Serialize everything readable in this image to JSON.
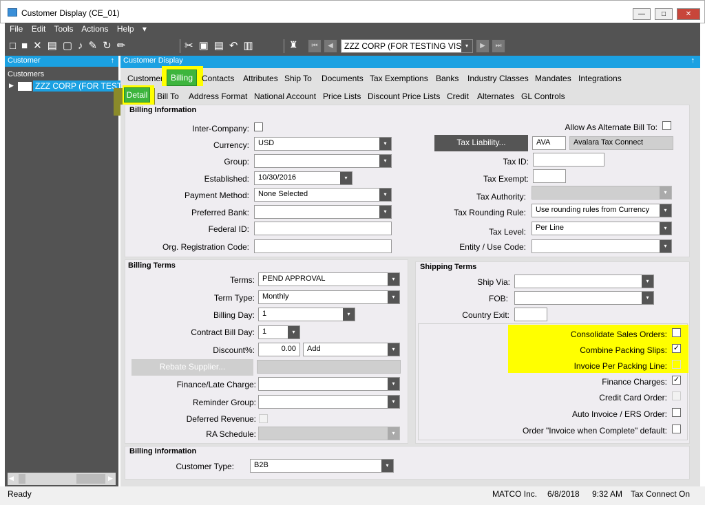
{
  "window": {
    "title": "Customer Display (CE_01)",
    "btn_min": "—",
    "btn_max": "□",
    "btn_close": "✕"
  },
  "menu": [
    "File",
    "Edit",
    "Tools",
    "Actions",
    "Help"
  ],
  "menu_more": "▾",
  "toolbar": {
    "icons": "□■✕▤▢♪✎↻✏",
    "icons2": "✂▣▤↶▥",
    "combo_value": "ZZZ CORP (FOR TESTING VIS",
    "combo_arrow": "▾",
    "nav_first": "⏮",
    "nav_prev": "◀",
    "nav_next": "▶",
    "nav_last": "⏭",
    "binoculars": "♜"
  },
  "left": {
    "header": "Customer",
    "pin": "↑",
    "section": "Customers",
    "node": "ZZZ CORP (FOR TEST",
    "expander": "▶"
  },
  "main_header": {
    "title": "Customer Display",
    "pin": "↑"
  },
  "tabs": [
    "Customer",
    "Billing",
    "Contacts",
    "Attributes",
    "Ship To",
    "Documents",
    "Tax Exemptions",
    "Banks",
    "Industry Classes",
    "Mandates",
    "Integrations"
  ],
  "subtabs": [
    "Detail",
    "Bill To",
    "Address Format",
    "National Account",
    "Price Lists",
    "Discount Price Lists",
    "Credit",
    "Alternates",
    "GL Controls"
  ],
  "billing_info": {
    "title": "Billing Information",
    "inter_company": "Inter-Company:",
    "currency_label": "Currency:",
    "currency": "USD",
    "group_label": "Group:",
    "group": "",
    "established_label": "Established:",
    "established": "10/30/2016",
    "payment_label": "Payment Method:",
    "payment": "None Selected",
    "bank_label": "Preferred Bank:",
    "bank": "",
    "federal_label": "Federal ID:",
    "federal": "",
    "orgreg_label": "Org. Registration Code:",
    "orgreg": "",
    "alt_bill": "Allow As Alternate Bill To:",
    "tax_liability_btn": "Tax Liability...",
    "tax_code": "AVA",
    "tax_name": "Avalara Tax Connect",
    "taxid_label": "Tax ID:",
    "taxid": "",
    "taxexempt_label": "Tax Exempt:",
    "taxexempt": "",
    "taxauth_label": "Tax Authority:",
    "taxauth": "",
    "rounding_label": "Tax Rounding Rule:",
    "rounding": "Use rounding rules from Currency",
    "taxlevel_label": "Tax Level:",
    "taxlevel": "Per Line",
    "entity_label": "Entity / Use Code:",
    "entity": ""
  },
  "billing_terms": {
    "title": "Billing Terms",
    "terms_label": "Terms:",
    "terms": "PEND APPROVAL",
    "termtype_label": "Term Type:",
    "termtype": "Monthly",
    "billday_label": "Billing Day:",
    "billday": "1",
    "contract_label": "Contract Bill Day:",
    "contract": "1",
    "discount_label": "Discount%:",
    "discount": "0.00",
    "discount_mode": "Add",
    "rebate_btn": "Rebate Supplier...",
    "rebate": "",
    "finance_label": "Finance/Late Charge:",
    "finance": "",
    "reminder_label": "Reminder Group:",
    "reminder": "",
    "deferred_label": "Deferred Revenue:",
    "ra_label": "RA Schedule:",
    "ra": ""
  },
  "shipping": {
    "title": "Shipping Terms",
    "shipvia_label": "Ship Via:",
    "shipvia": "",
    "fob_label": "FOB:",
    "fob": "",
    "country_label": "Country Exit:",
    "country": "",
    "consolidate": "Consolidate Sales Orders:",
    "combine": "Combine Packing Slips:",
    "invoice_pack": "Invoice Per Packing Line:",
    "finance_charges": "Finance Charges:",
    "credit_card": "Credit Card Order:",
    "auto_invoice": "Auto Invoice / ERS Order:",
    "order_complete": "Order \"Invoice when Complete\" default:",
    "check_mark": "✓"
  },
  "billing_info2": {
    "title": "Billing Information",
    "custtype_label": "Customer Type:",
    "custtype": "B2B"
  },
  "status": {
    "ready": "Ready",
    "company": "MATCO Inc.",
    "date": "6/8/2018",
    "time": "9:32 AM",
    "tax": "Tax Connect On"
  },
  "arrow": "▾",
  "left_scroll_l": "◀",
  "left_scroll_r": "▶"
}
